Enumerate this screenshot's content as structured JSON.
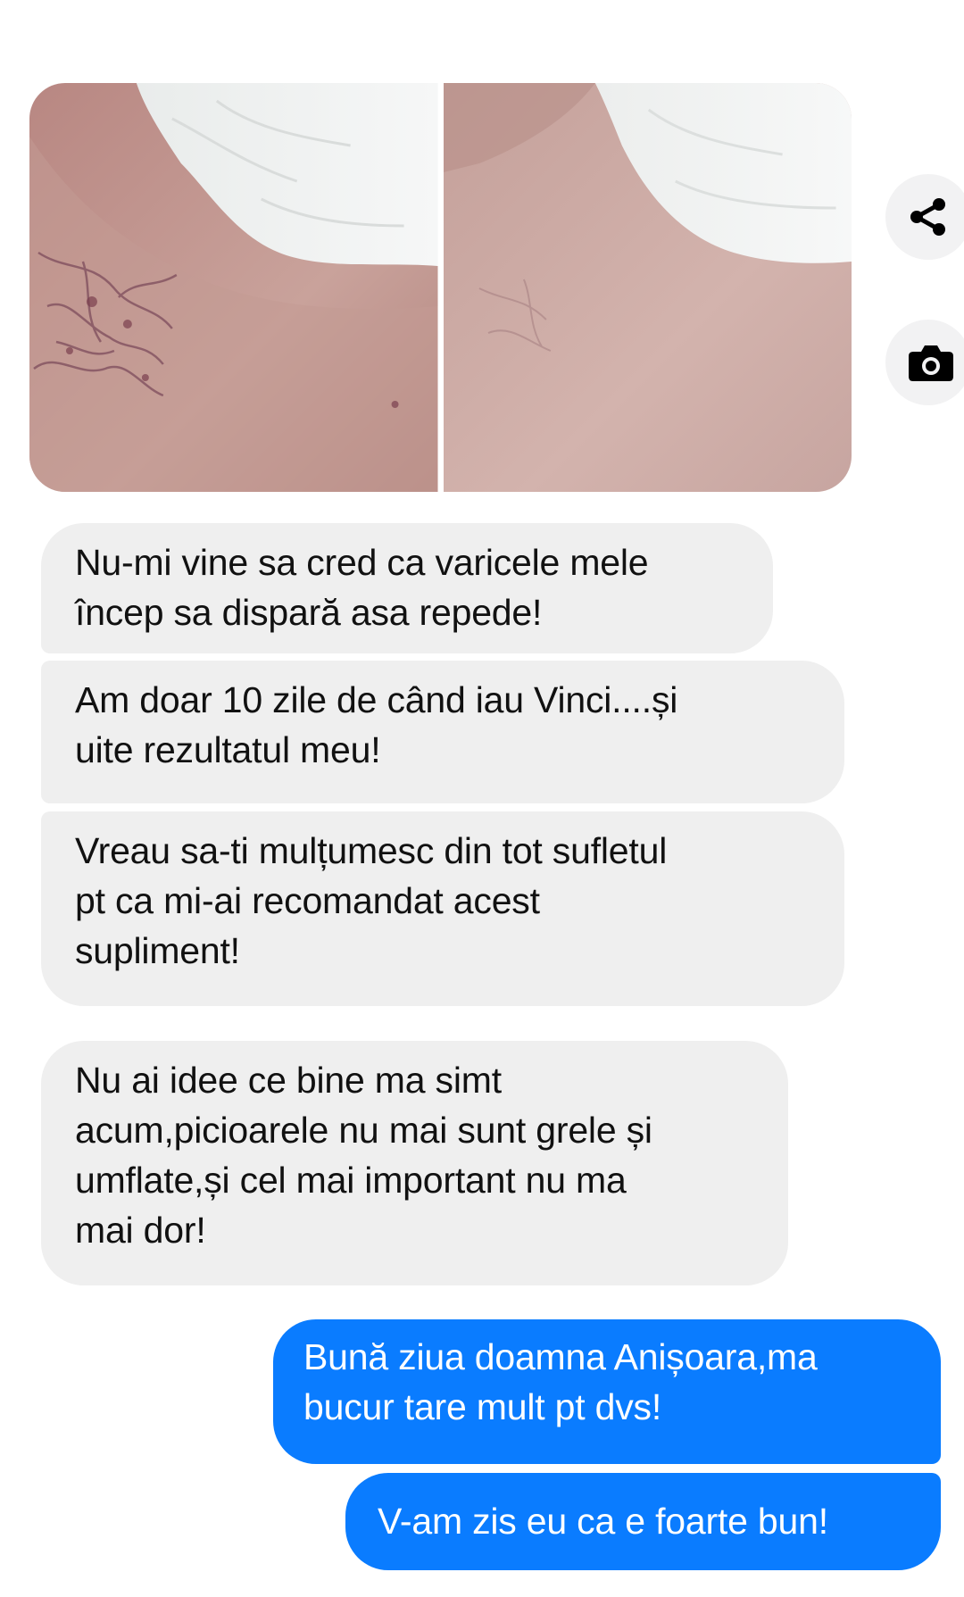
{
  "conversation": {
    "messages": [
      {
        "direction": "incoming",
        "text": "Nu-mi vine sa cred ca varicele mele\nîncep sa dispară asa repede!"
      },
      {
        "direction": "incoming",
        "text": "Am doar 10 zile de când iau Vinci....și\nuite rezultatul meu!"
      },
      {
        "direction": "incoming",
        "text": "Vreau sa-ti mulțumesc din tot sufletul\npt ca mi-ai recomandat acest\nsupliment!"
      },
      {
        "direction": "incoming",
        "text": "Nu ai idee ce bine ma simt\nacum,picioarele nu mai sunt grele și\numflate,și cel mai important nu ma\nmai dor!"
      },
      {
        "direction": "outgoing",
        "text": "Bună ziua doamna Anișoara,ma\nbucur tare mult pt dvs!"
      },
      {
        "direction": "outgoing",
        "text": "V-am zis eu ca e foarte bun!"
      }
    ]
  },
  "side_actions": {
    "share_icon": "share-icon",
    "camera_icon": "camera-icon"
  },
  "colors": {
    "incoming_bubble": "#efefef",
    "outgoing_bubble": "#0a7cff",
    "incoming_text": "#111111",
    "outgoing_text": "#ffffff"
  }
}
